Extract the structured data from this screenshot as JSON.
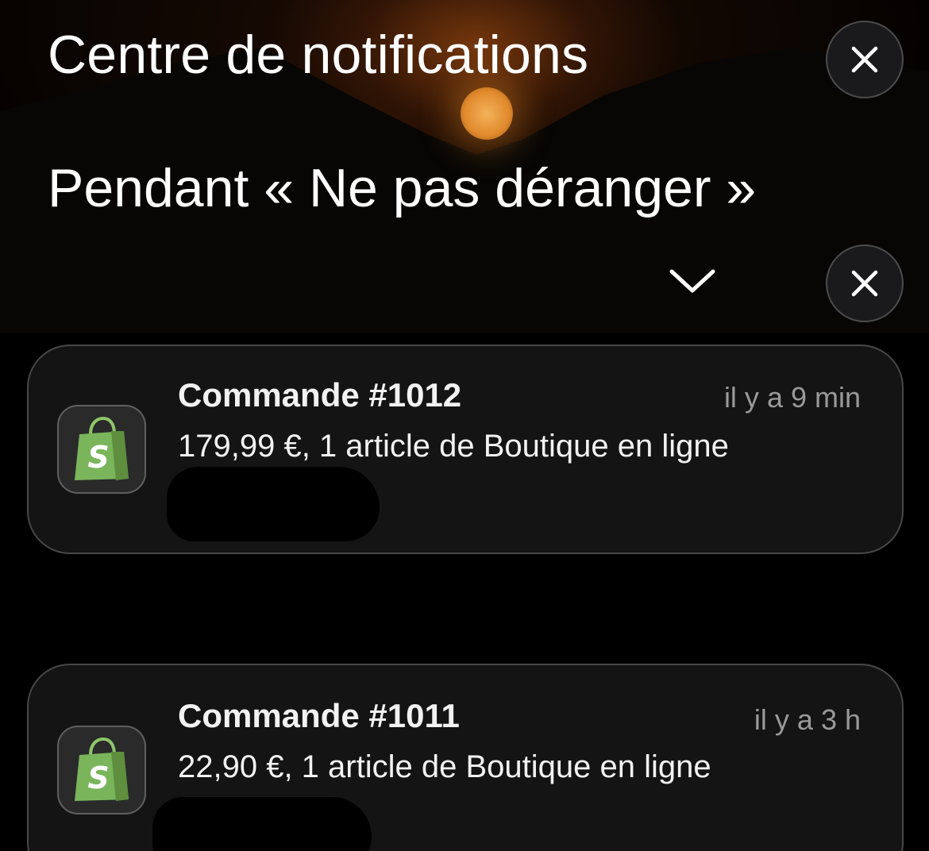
{
  "header": {
    "title": "Centre de notifications",
    "close_icon": "close-icon"
  },
  "section": {
    "title": "Pendant « Ne pas déranger »",
    "collapse_icon": "chevron-down-icon",
    "close_icon": "close-icon"
  },
  "notifications": [
    {
      "app_icon": "shopify-bag-icon",
      "title": "Commande #1012",
      "time": "il y a 9 min",
      "body": "179,99 €, 1 article de Boutique en ligne"
    },
    {
      "app_icon": "shopify-bag-icon",
      "title": "Commande #1011",
      "time": "il y a 3 h",
      "body": "22,90 €, 1 article de Boutique en ligne"
    }
  ],
  "colors": {
    "background": "#000000",
    "card": "#141414",
    "time_text": "#9a9a9a",
    "shopify_green": "#7ab55c"
  }
}
